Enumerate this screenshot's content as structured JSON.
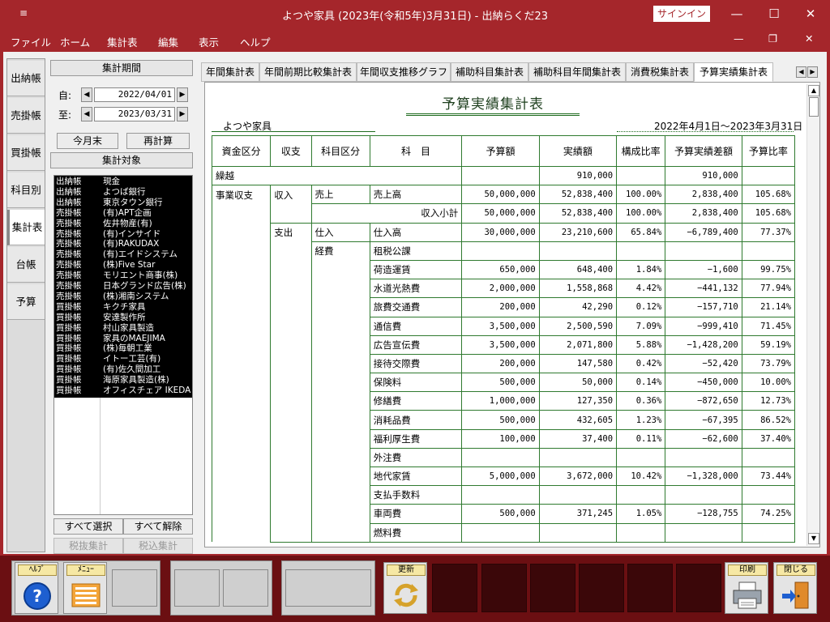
{
  "window": {
    "title": "よつや家具 (2023年(令和5年)3月31日)  -  出納らくだ23",
    "signin_label": "サインイン",
    "sys_icon": "≡",
    "minimize": "—",
    "maximize": "☐",
    "close": "✕"
  },
  "menu": {
    "items": [
      "ファイル",
      "ホーム",
      "集計表",
      "編集",
      "表示",
      "ヘルプ"
    ],
    "ribbon_min": "—",
    "ribbon_restore": "❐",
    "ribbon_close": "✕"
  },
  "left_tabs": [
    "出納帳",
    "売掛帳",
    "買掛帳",
    "科目別",
    "集計表",
    "台帳",
    "予算"
  ],
  "period": {
    "header": "集計期間",
    "from_label": "自:",
    "from_value": "2022/04/01",
    "to_label": "至:",
    "to_value": "2023/03/31",
    "month_end_button": "今月末",
    "recalc_button": "再計算",
    "target_header": "集計対象",
    "select_all_button": "すべて選択",
    "clear_all_button": "すべて解除",
    "tax_excl_button": "税抜集計",
    "tax_incl_button": "税込集計"
  },
  "accounts": [
    [
      "出納帳",
      "現金"
    ],
    [
      "出納帳",
      "よつば銀行"
    ],
    [
      "出納帳",
      "東京タウン銀行"
    ],
    [
      "売掛帳",
      "(有)APT企画"
    ],
    [
      "売掛帳",
      "佐井物産(有)"
    ],
    [
      "売掛帳",
      "(有)インサイド"
    ],
    [
      "売掛帳",
      "(有)RAKUDAX"
    ],
    [
      "売掛帳",
      "(有)エイドシステム"
    ],
    [
      "売掛帳",
      "(株)Five Star"
    ],
    [
      "売掛帳",
      "モリエント商事(株)"
    ],
    [
      "売掛帳",
      "日本グランド広告(株)"
    ],
    [
      "売掛帳",
      "(株)湘南システム"
    ],
    [
      "買掛帳",
      "キクチ家具"
    ],
    [
      "買掛帳",
      "安達製作所"
    ],
    [
      "買掛帳",
      "村山家具製造"
    ],
    [
      "買掛帳",
      "家具のMAEJIMA"
    ],
    [
      "買掛帳",
      "(株)毎朝工業"
    ],
    [
      "買掛帳",
      "イトー工芸(有)"
    ],
    [
      "買掛帳",
      "(有)佐久間加工"
    ],
    [
      "買掛帳",
      "海原家具製造(株)"
    ],
    [
      "買掛帳",
      "オフィスチェア IKEDA"
    ]
  ],
  "top_tabs": [
    "年間集計表",
    "年間前期比較集計表",
    "年間収支推移グラフ",
    "補助科目集計表",
    "補助科目年間集計表",
    "消費税集計表",
    "予算実績集計表"
  ],
  "tab_scroll": {
    "left": "◀",
    "right": "▶"
  },
  "report": {
    "title": "予算実績集計表",
    "company": "よつや家具",
    "period": "2022年4月1日～2023年3月31日",
    "headers": [
      "資金区分",
      "収支",
      "科目区分",
      "科　目",
      "予算額",
      "実績額",
      "構成比率",
      "予算実績差額",
      "予算比率"
    ],
    "carry": {
      "label": "繰越",
      "actual": "910,000",
      "diff": "910,000"
    },
    "rows": [
      {
        "c1": "事業収支",
        "c2": "収入",
        "c3": "売上",
        "c4": "売上高",
        "budget": "50,000,000",
        "actual": "52,838,400",
        "ratio": "100.00%",
        "diff": "2,838,400",
        "bratio": "105.68%"
      },
      {
        "c1": "",
        "c2": "",
        "c3": "",
        "c4": "収入小計",
        "budget": "50,000,000",
        "actual": "52,838,400",
        "ratio": "100.00%",
        "diff": "2,838,400",
        "bratio": "105.68%"
      },
      {
        "c1": "",
        "c2": "支出",
        "c3": "仕入",
        "c4": "仕入高",
        "budget": "30,000,000",
        "actual": "23,210,600",
        "ratio": "65.84%",
        "diff": "−6,789,400",
        "bratio": "77.37%"
      },
      {
        "c1": "",
        "c2": "",
        "c3": "経費",
        "c4": "租税公課",
        "budget": "",
        "actual": "",
        "ratio": "",
        "diff": "",
        "bratio": ""
      },
      {
        "c1": "",
        "c2": "",
        "c3": "",
        "c4": "荷造運賃",
        "budget": "650,000",
        "actual": "648,400",
        "ratio": "1.84%",
        "diff": "−1,600",
        "bratio": "99.75%"
      },
      {
        "c1": "",
        "c2": "",
        "c3": "",
        "c4": "水道光熱費",
        "budget": "2,000,000",
        "actual": "1,558,868",
        "ratio": "4.42%",
        "diff": "−441,132",
        "bratio": "77.94%"
      },
      {
        "c1": "",
        "c2": "",
        "c3": "",
        "c4": "旅費交通費",
        "budget": "200,000",
        "actual": "42,290",
        "ratio": "0.12%",
        "diff": "−157,710",
        "bratio": "21.14%"
      },
      {
        "c1": "",
        "c2": "",
        "c3": "",
        "c4": "通信費",
        "budget": "3,500,000",
        "actual": "2,500,590",
        "ratio": "7.09%",
        "diff": "−999,410",
        "bratio": "71.45%"
      },
      {
        "c1": "",
        "c2": "",
        "c3": "",
        "c4": "広告宣伝費",
        "budget": "3,500,000",
        "actual": "2,071,800",
        "ratio": "5.88%",
        "diff": "−1,428,200",
        "bratio": "59.19%"
      },
      {
        "c1": "",
        "c2": "",
        "c3": "",
        "c4": "接待交際費",
        "budget": "200,000",
        "actual": "147,580",
        "ratio": "0.42%",
        "diff": "−52,420",
        "bratio": "73.79%"
      },
      {
        "c1": "",
        "c2": "",
        "c3": "",
        "c4": "保険料",
        "budget": "500,000",
        "actual": "50,000",
        "ratio": "0.14%",
        "diff": "−450,000",
        "bratio": "10.00%"
      },
      {
        "c1": "",
        "c2": "",
        "c3": "",
        "c4": "修繕費",
        "budget": "1,000,000",
        "actual": "127,350",
        "ratio": "0.36%",
        "diff": "−872,650",
        "bratio": "12.73%"
      },
      {
        "c1": "",
        "c2": "",
        "c3": "",
        "c4": "消耗品費",
        "budget": "500,000",
        "actual": "432,605",
        "ratio": "1.23%",
        "diff": "−67,395",
        "bratio": "86.52%"
      },
      {
        "c1": "",
        "c2": "",
        "c3": "",
        "c4": "福利厚生費",
        "budget": "100,000",
        "actual": "37,400",
        "ratio": "0.11%",
        "diff": "−62,600",
        "bratio": "37.40%"
      },
      {
        "c1": "",
        "c2": "",
        "c3": "",
        "c4": "外注費",
        "budget": "",
        "actual": "",
        "ratio": "",
        "diff": "",
        "bratio": ""
      },
      {
        "c1": "",
        "c2": "",
        "c3": "",
        "c4": "地代家賃",
        "budget": "5,000,000",
        "actual": "3,672,000",
        "ratio": "10.42%",
        "diff": "−1,328,000",
        "bratio": "73.44%"
      },
      {
        "c1": "",
        "c2": "",
        "c3": "",
        "c4": "支払手数料",
        "budget": "",
        "actual": "",
        "ratio": "",
        "diff": "",
        "bratio": ""
      },
      {
        "c1": "",
        "c2": "",
        "c3": "",
        "c4": "車両費",
        "budget": "500,000",
        "actual": "371,245",
        "ratio": "1.05%",
        "diff": "−128,755",
        "bratio": "74.25%"
      },
      {
        "c1": "",
        "c2": "",
        "c3": "",
        "c4": "燃料費",
        "budget": "",
        "actual": "",
        "ratio": "",
        "diff": "",
        "bratio": ""
      }
    ]
  },
  "scroll": {
    "up": "▲",
    "down": "▼"
  },
  "toolbar": {
    "help_label": "ﾍﾙﾌﾟ",
    "menu_label": "ﾒﾆｭｰ",
    "update_label": "更新",
    "print_label": "印刷",
    "close_label": "閉じる"
  },
  "colors": {
    "frame": "#a5262b",
    "toolbar": "#6b0f12",
    "grid": "#2f7a2f"
  }
}
